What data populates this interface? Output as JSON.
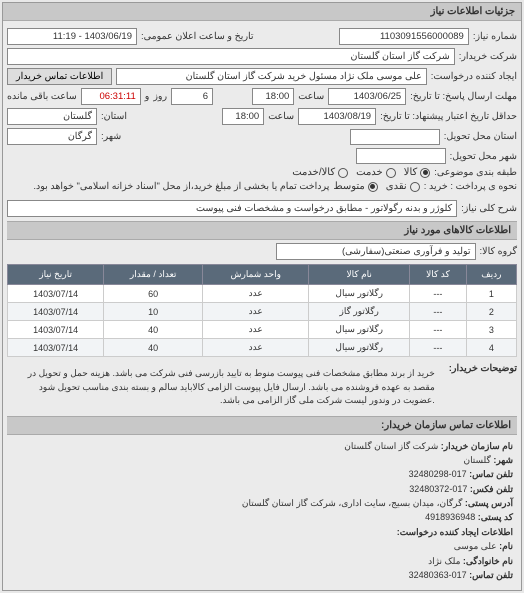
{
  "panel_title": "جزئیات اطلاعات نیاز",
  "header": {
    "number_label": "شماره نیاز:",
    "number_value": "1103091556000089",
    "datetime_label": "تاریخ و ساعت اعلان عمومی:",
    "datetime_value": "1403/06/19 - 11:19",
    "buyer_label": "شرکت خریدار:",
    "buyer_value": "شرکت گاز استان گلستان",
    "requester_label": "ایجاد کننده درخواست:",
    "requester_value": "علی موسی ملک نژاد مسئول خرید شرکت گاز استان گلستان",
    "contact_btn": "اطلاعات تماس خریدار",
    "reply_until_label": "مهلت ارسال پاسخ: تا تاریخ:",
    "reply_until_date": "1403/06/25",
    "time_label": "ساعت",
    "reply_until_time": "18:00",
    "remain_label_1": "و",
    "remain_days": "6",
    "remain_label_2": "روز",
    "remain_time": "06:31:11",
    "remain_label_3": "ساعت باقی مانده",
    "valid_until_label": "حداقل تاریخ اعتبار پیشنهاد: تا تاریخ:",
    "valid_until_date": "1403/08/19",
    "valid_until_time": "18:00",
    "province_label": "استان:",
    "province_value": "گلستان",
    "delivery_place_label": "استان محل تحویل:",
    "city_label": "شهر:",
    "city_value": "گرگان",
    "delivery_city_label": "شهر محل تحویل:",
    "budget_label": "طبقه بندی موضوعی:",
    "budget_options": {
      "goods": "کالا",
      "service": "خدمت",
      "both": "کالا/خدمت"
    },
    "budget_selected": "goods",
    "payment_label": "نحوه ی پرداخت : خرید :",
    "payment_options": {
      "cash": "نقدی",
      "medium": "متوسط"
    },
    "payment_selected": "medium",
    "payment_note": "پرداخت تمام یا بخشی از مبلغ خرید،از محل \"اسناد خزانه اسلامی\" خواهد بود."
  },
  "desc": {
    "label": "شرح کلی نیاز:",
    "value": "کلوژر و بدنه رگولاتور - مطابق درخواست و مشخصات فنی پیوست"
  },
  "goods_section_title": "اطلاعات کالاهای مورد نیاز",
  "group": {
    "label": "گروه کالا:",
    "value": "تولید و فرآوری صنعتی(سفارشی)"
  },
  "table": {
    "headers": [
      "ردیف",
      "کد کالا",
      "نام کالا",
      "واحد شمارش",
      "تعداد / مقدار",
      "تاریخ نیاز"
    ],
    "rows": [
      {
        "idx": "1",
        "code": "---",
        "name": "رگلاتور سیال",
        "unit": "عدد",
        "qty": "60",
        "date": "1403/07/14"
      },
      {
        "idx": "2",
        "code": "---",
        "name": "رگلاتور گاز",
        "unit": "عدد",
        "qty": "10",
        "date": "1403/07/14"
      },
      {
        "idx": "3",
        "code": "---",
        "name": "رگلاتور سیال",
        "unit": "عدد",
        "qty": "40",
        "date": "1403/07/14"
      },
      {
        "idx": "4",
        "code": "---",
        "name": "رگلاتور سیال",
        "unit": "عدد",
        "qty": "40",
        "date": "1403/07/14"
      }
    ]
  },
  "notes": {
    "label": "توضیحات خریدار:",
    "text": "خرید از برند مطابق مشخصات فنی پیوست منوط به تایید بازرسی فنی شرکت می باشد. هزینه حمل و تحویل در مقصد به عهده فروشنده می باشد. ارسال فایل پیوست الزامی کالاباید سالم و بسته بندی مناسب تحویل شود .عضویت در وندور لیست شرکت ملی گاز الزامی می باشد."
  },
  "org_section_title": "اطلاعات تماس سازمان خریدار:",
  "org": {
    "name_k": "نام سازمان خریدار:",
    "name_v": "شرکت گاز استان گلستان",
    "prov_k": "شهر:",
    "prov_v": "گلستان",
    "tel_k": "تلفن تماس:",
    "tel_v": "017-32480298",
    "fax_k": "تلفن فکس:",
    "fax_v": "017-32480372",
    "addr_k": "آدرس پستی:",
    "addr_v": "گرگان، میدان بسیج، سایت اداری، شرکت گاز استان گلستان",
    "zip_k": "کد پستی:",
    "zip_v": "4918936948",
    "creator_title": "اطلاعات ایجاد کننده درخواست:",
    "creator_name_k": "نام:",
    "creator_name_v": "علی موسی",
    "creator_family_k": "نام خانوادگی:",
    "creator_family_v": "ملک نژاد",
    "creator_tel_k": "تلفن تماس:",
    "creator_tel_v": "017-32480363"
  }
}
